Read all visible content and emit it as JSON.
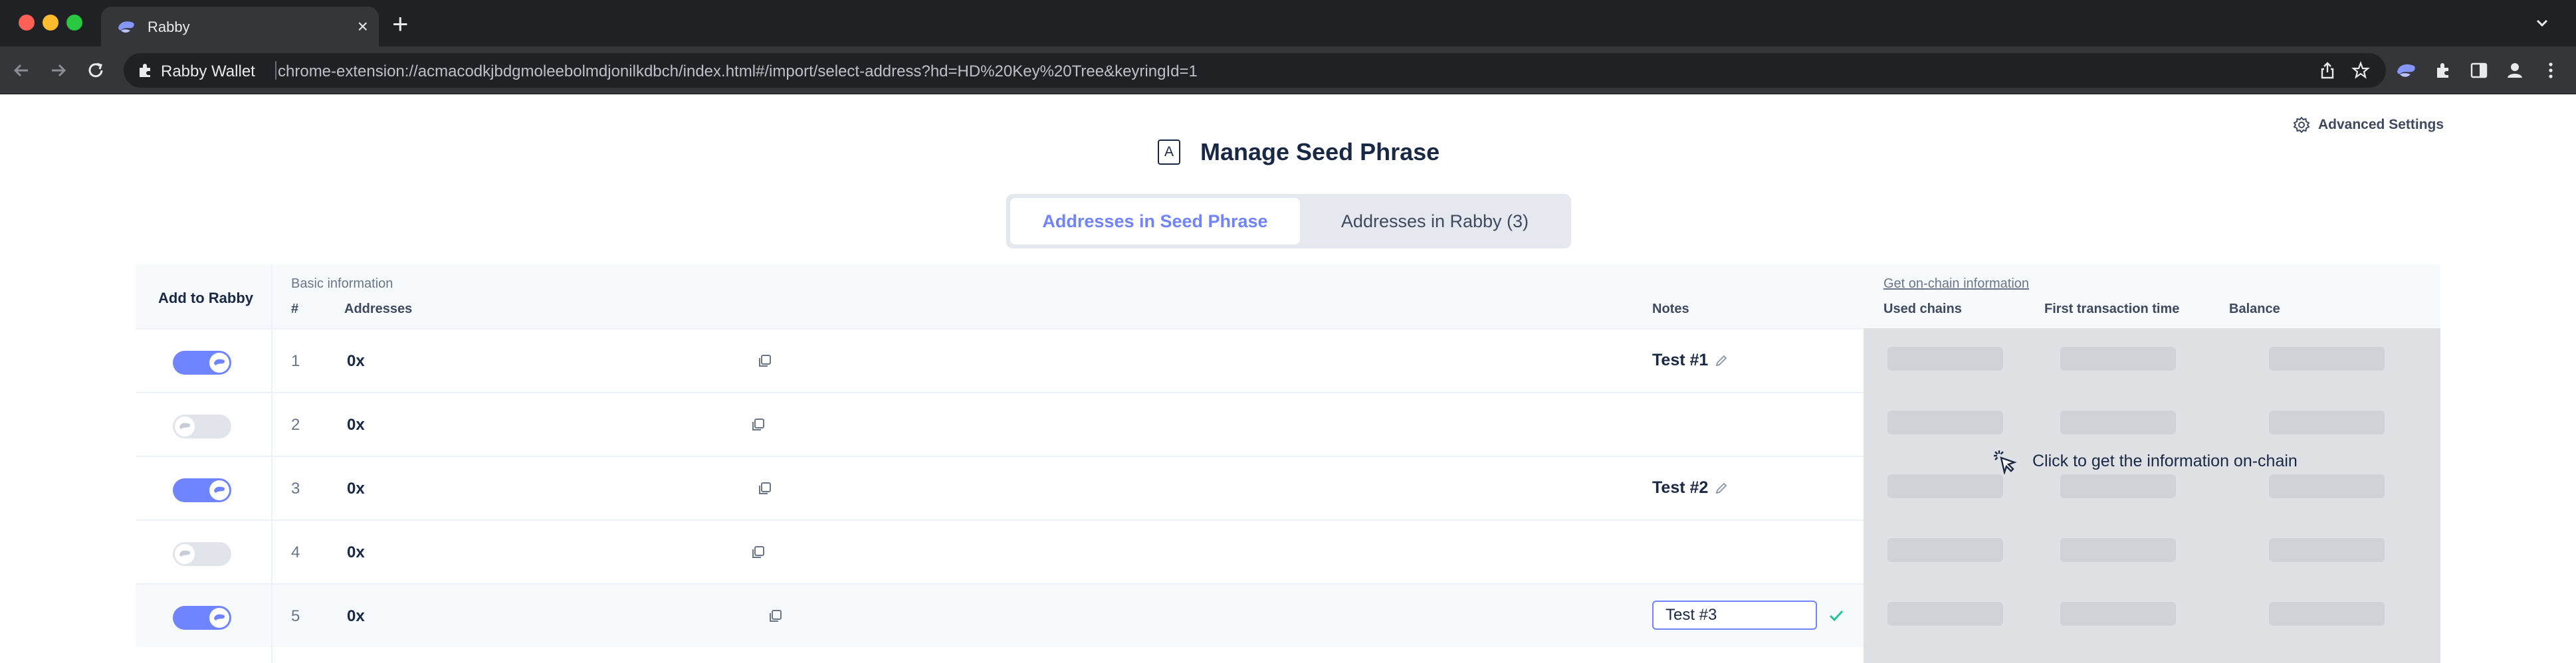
{
  "browser": {
    "tab_title": "Rabby",
    "tab_close": "×",
    "new_tab": "+",
    "omnibox_label": "Rabby Wallet",
    "url": "chrome-extension://acmacodkjbdgmoleebolmdjonilkdbch/index.html#/import/select-address?hd=HD%20Key%20Tree&keyringId=1"
  },
  "page": {
    "advanced_settings": "Advanced Settings",
    "title_badge": "A",
    "title": "Manage Seed Phrase",
    "tabs": [
      {
        "label": "Addresses in Seed Phrase",
        "active": true
      },
      {
        "label": "Addresses in Rabby (3)",
        "active": false
      }
    ]
  },
  "table": {
    "headers": {
      "add": "Add to Rabby",
      "basic": "Basic information",
      "num": "#",
      "addresses": "Addresses",
      "notes": "Notes",
      "onchain_link": "Get on-chain information",
      "used_chains": "Used chains",
      "first_tx": "First transaction time",
      "balance": "Balance"
    },
    "rows": [
      {
        "num": "1",
        "address": "0x",
        "added": true,
        "note": "Test #1"
      },
      {
        "num": "2",
        "address": "0x",
        "added": false,
        "note": ""
      },
      {
        "num": "3",
        "address": "0x",
        "added": true,
        "note": "Test #2"
      },
      {
        "num": "4",
        "address": "0x",
        "added": false,
        "note": ""
      },
      {
        "num": "5",
        "address": "0x",
        "added": true,
        "note": "Test #3",
        "editing": true
      }
    ],
    "onchain_cta": "Click to get the information on-chain"
  },
  "colors": {
    "accent": "#7084ff",
    "toggle_off": "#e1e5eb",
    "confirm": "#27c193"
  },
  "icons": [
    "rabby-logo-icon",
    "close-icon",
    "plus-icon",
    "chevron-down-icon",
    "back-icon",
    "forward-icon",
    "reload-icon",
    "extension-icon",
    "share-icon",
    "star-icon",
    "puzzle-icon",
    "sidepanel-icon",
    "profile-icon",
    "more-icon",
    "settings-icon",
    "copy-icon",
    "edit-icon",
    "check-icon",
    "loading-cursor-icon"
  ]
}
